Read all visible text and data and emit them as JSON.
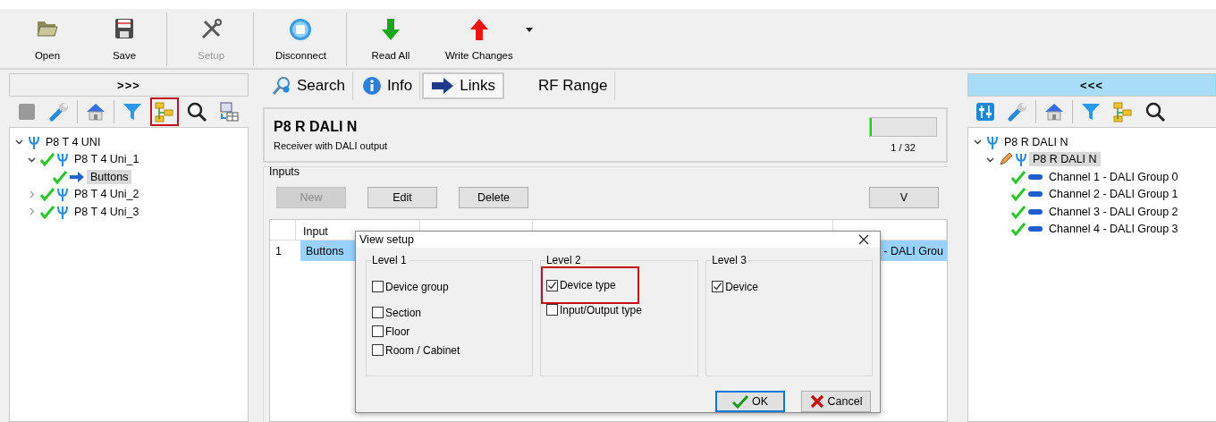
{
  "toolbar": {
    "buttons": [
      {
        "label": "Open",
        "disabled": false
      },
      {
        "label": "Save",
        "disabled": false
      },
      {
        "label": "Setup",
        "disabled": true
      },
      {
        "label": "Disconnect",
        "disabled": false
      },
      {
        "label": "Read All",
        "disabled": false
      },
      {
        "label": "Write Changes",
        "disabled": false
      }
    ]
  },
  "left_panel": {
    "header": ">>>",
    "tools": [
      {
        "highlighted": false
      },
      {
        "highlighted": false
      },
      {
        "highlighted": false
      },
      {
        "highlighted": false
      },
      {
        "highlighted": true
      },
      {
        "highlighted": false
      },
      {
        "highlighted": false
      }
    ],
    "tree": [
      {
        "label": "P8 T 4 UNI",
        "kind": "device",
        "expanded": true,
        "children": [
          {
            "label": "P8 T 4 Uni_1",
            "kind": "device",
            "checked": true,
            "expanded": true,
            "children": [
              {
                "label": "Buttons",
                "kind": "input",
                "checked": true,
                "selected": true
              }
            ]
          },
          {
            "label": "P8 T 4 Uni_2",
            "kind": "device",
            "checked": true,
            "expanded": false
          },
          {
            "label": "P8 T 4 Uni_3",
            "kind": "device",
            "checked": true,
            "expanded": false
          }
        ]
      }
    ]
  },
  "center": {
    "tabs": [
      {
        "label": "Search",
        "selected": false
      },
      {
        "label": "Info",
        "selected": false
      },
      {
        "label": "Links",
        "selected": true
      },
      {
        "label": "RF Range",
        "selected": false
      }
    ],
    "device": {
      "name": "P8 R DALI N",
      "description": "Receiver with DALI output",
      "level": 0.03,
      "reading": "1 / 32"
    },
    "inputs": {
      "title": "Inputs",
      "buttons": [
        {
          "label": "New",
          "disabled": true
        },
        {
          "label": "Edit",
          "disabled": false
        },
        {
          "label": "Delete",
          "disabled": false
        }
      ],
      "view_button": "V",
      "table": {
        "columns": [
          "Input"
        ],
        "rows": [
          {
            "number": "1",
            "input": "Buttons",
            "output": "- DALI Grou",
            "selected": true
          }
        ]
      }
    }
  },
  "right_panel": {
    "header": "<<<",
    "tools": [
      {
        "highlighted": false
      },
      {
        "highlighted": false
      },
      {
        "highlighted": false
      },
      {
        "highlighted": false
      },
      {
        "highlighted": false
      },
      {
        "highlighted": false
      }
    ],
    "tree": [
      {
        "label": "P8 R DALI N",
        "kind": "device",
        "expanded": true,
        "children": [
          {
            "label": "P8 R DALI N",
            "kind": "device",
            "edited": true,
            "selected": true,
            "expanded": true,
            "children": [
              {
                "label": "Channel 1 - DALI Group 0",
                "kind": "channel",
                "checked": true
              },
              {
                "label": "Channel 2 - DALI Group 1",
                "kind": "channel",
                "checked": true
              },
              {
                "label": "Channel 3 - DALI Group 2",
                "kind": "channel",
                "checked": true
              },
              {
                "label": "Channel 4 - DALI Group 3",
                "kind": "channel",
                "checked": true
              }
            ]
          }
        ]
      }
    ]
  },
  "dialog": {
    "title": "View setup",
    "levels": [
      {
        "title": "Level 1",
        "options": [
          {
            "label": "Device group",
            "checked": false,
            "highlighted": false
          },
          {
            "label": "Section",
            "checked": false,
            "highlighted": false
          },
          {
            "label": "Floor",
            "checked": false,
            "highlighted": false
          },
          {
            "label": "Room / Cabinet",
            "checked": false,
            "highlighted": false
          }
        ]
      },
      {
        "title": "Level 2",
        "options": [
          {
            "label": "Device type",
            "checked": true,
            "highlighted": true
          },
          {
            "label": "Input/Output type",
            "checked": false,
            "highlighted": false
          }
        ]
      },
      {
        "title": "Level 3",
        "options": [
          {
            "label": "Device",
            "checked": true,
            "highlighted": false
          }
        ]
      }
    ],
    "buttons": [
      {
        "label": "OK",
        "kind": "ok",
        "default": true
      },
      {
        "label": "Cancel",
        "kind": "cancel",
        "default": false
      }
    ]
  }
}
